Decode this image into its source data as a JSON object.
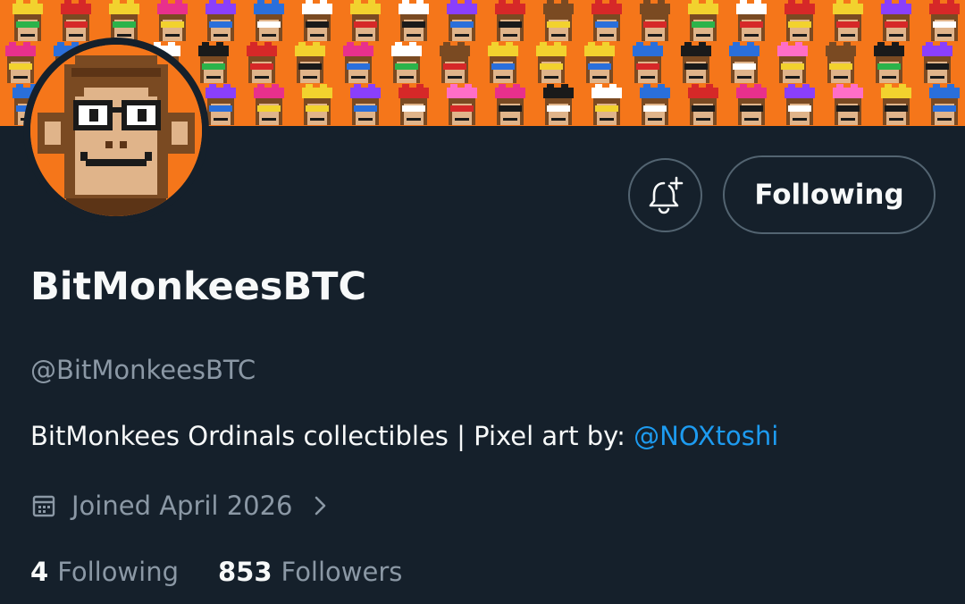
{
  "banner": {
    "background": "#f5761a",
    "image_description_icon": "pixel-monkey-collage-banner"
  },
  "avatar": {
    "icon": "pixel-monkey-avatar",
    "background": "#f5761a"
  },
  "actions": {
    "notify_icon": "bell-plus-icon",
    "following_label": "Following"
  },
  "profile": {
    "display_name": "BitMonkeesBTC",
    "handle": "@BitMonkeesBTC",
    "bio_text": "BitMonkees Ordinals collectibles | Pixel art by: ",
    "bio_mention": "@NOXtoshi",
    "joined": "Joined April 2026"
  },
  "stats": {
    "following_count": "4",
    "following_label": "Following",
    "followers_count": "853",
    "followers_label": "Followers"
  },
  "colors": {
    "background": "#15202b",
    "primary_text": "#f7f9f9",
    "secondary_text": "#8b98a5",
    "link": "#1d9bf0",
    "border": "#536471"
  }
}
